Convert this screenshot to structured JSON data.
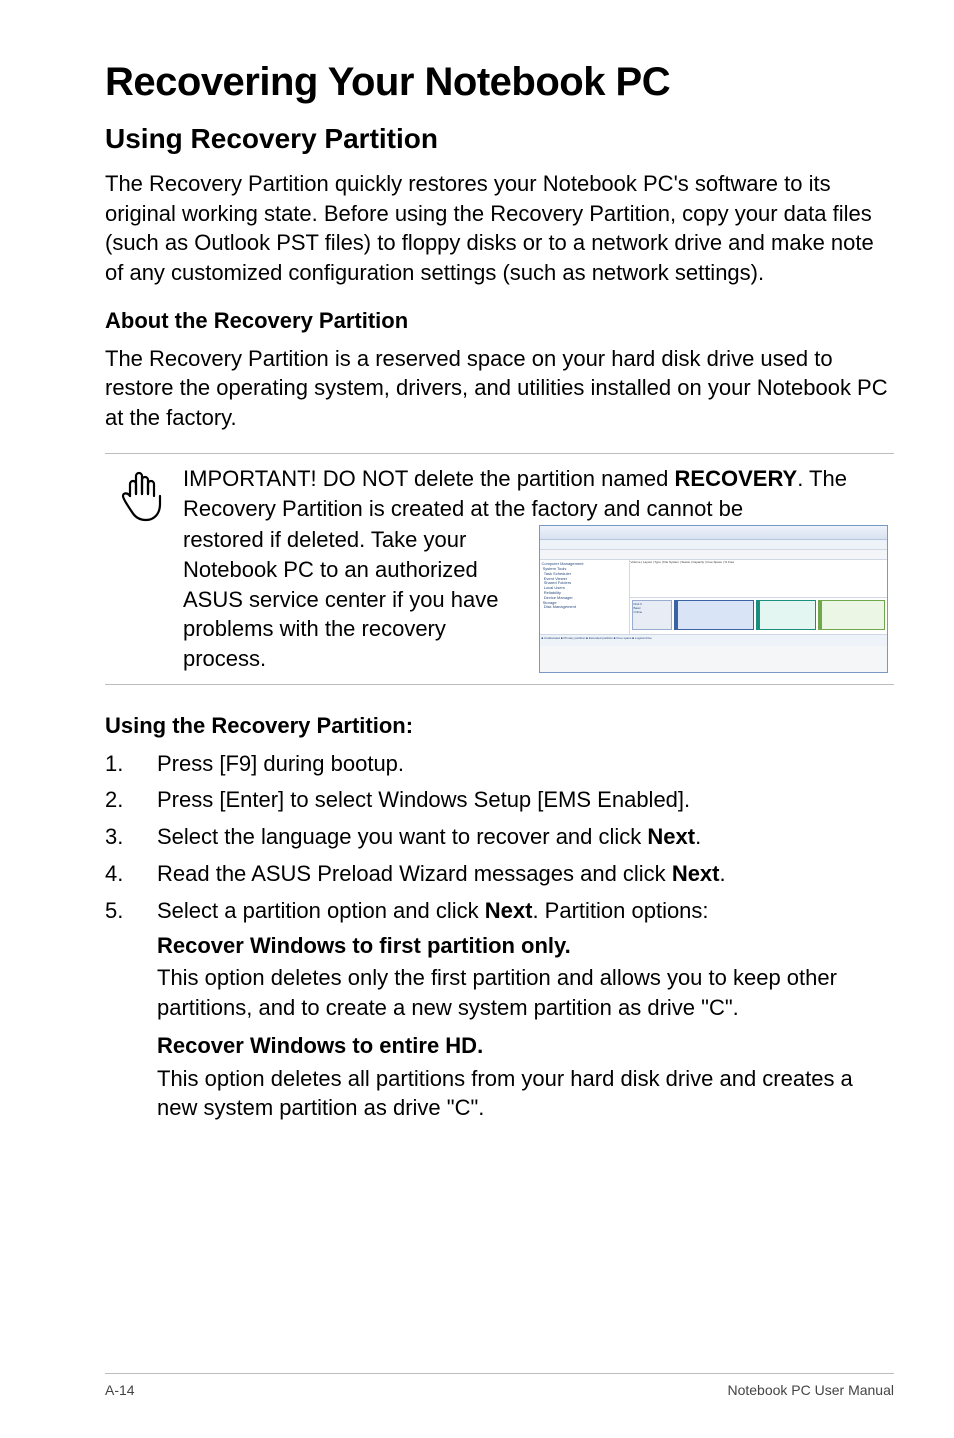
{
  "title": "Recovering Your Notebook PC",
  "section1": {
    "heading": "Using Recovery Partition",
    "intro": "The Recovery Partition quickly restores your Notebook PC's software to its original working state. Before using the Recovery Partition, copy your data files (such as Outlook PST files) to floppy disks or to a network drive and make note of any customized configuration settings (such as network settings)."
  },
  "about": {
    "heading": "About the Recovery Partition",
    "body": "The Recovery Partition is a reserved space on your hard disk drive used to restore the operating system, drivers, and utilities installed on your Notebook PC at the factory."
  },
  "callout": {
    "line1_pre": "IMPORTANT! DO NOT delete the partition named ",
    "line1_bold": "RECOVERY",
    "line1_post": ". The Recovery Partition is created at the factory and cannot be ",
    "line2": "restored if deleted. Take your Notebook PC to an authorized ASUS service center if you have problems with the recovery process."
  },
  "using": {
    "heading": "Using the Recovery Partition:",
    "steps": [
      {
        "text": "Press [F9] during bootup."
      },
      {
        "text": "Press [Enter] to select Windows Setup [EMS Enabled]."
      },
      {
        "text_pre": "Select the language you want to recover and click ",
        "bold": "Next",
        "text_post": "."
      },
      {
        "text_pre": "Read the ASUS Preload Wizard messages and click ",
        "bold": "Next",
        "text_post": "."
      },
      {
        "text_pre": "Select a partition option and click ",
        "bold": "Next",
        "text_post": ". Partition options:"
      }
    ],
    "sub": [
      {
        "title": "Recover Windows to first partition only.",
        "body": "This option deletes only the first partition and allows you to keep other partitions, and to create a new system partition as drive \"C\"."
      },
      {
        "title": "Recover Windows to entire HD.",
        "body": "This option deletes all partitions from your hard disk drive and creates a new system partition as drive \"C\"."
      }
    ]
  },
  "footer": {
    "left": "A-14",
    "right": "Notebook PC User Manual"
  }
}
